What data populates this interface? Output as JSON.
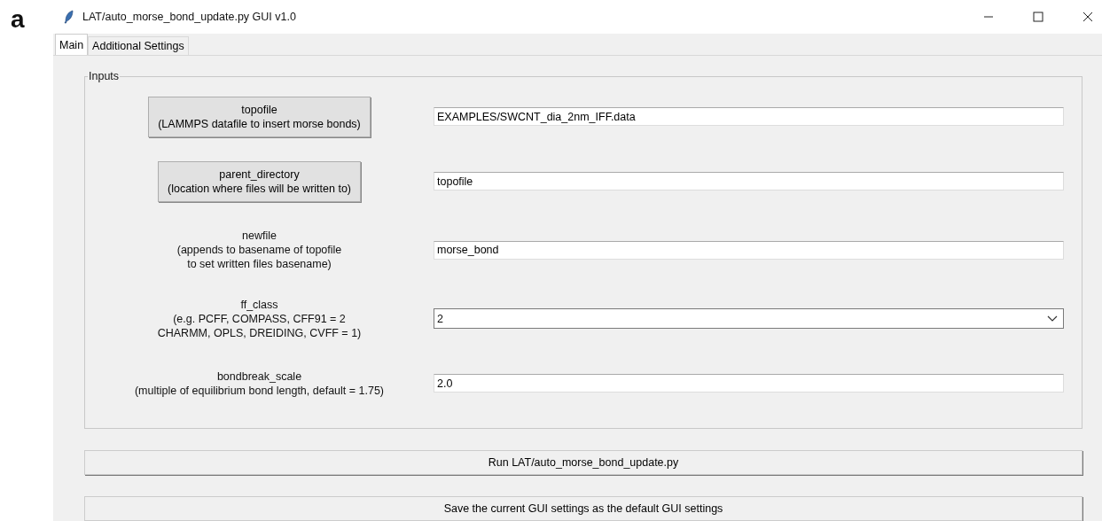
{
  "figure_label": "a",
  "window": {
    "title": "LAT/auto_morse_bond_update.py GUI v1.0"
  },
  "tabs": [
    {
      "label": "Main",
      "selected": true
    },
    {
      "label": "Additional Settings",
      "selected": false
    }
  ],
  "inputs": {
    "title": "Inputs",
    "rows": [
      {
        "label": {
          "kind": "button",
          "lines": [
            "topofile",
            "(LAMMPS datafile to insert morse bonds)"
          ]
        },
        "field": {
          "kind": "entry",
          "value": "EXAMPLES/SWCNT_dia_2nm_IFF.data"
        }
      },
      {
        "label": {
          "kind": "button",
          "lines": [
            "parent_directory",
            "(location where files will be written to)"
          ]
        },
        "field": {
          "kind": "entry",
          "value": "topofile"
        }
      },
      {
        "label": {
          "kind": "text",
          "lines": [
            "newfile",
            "(appends to basename of topofile",
            "to set written files basename)"
          ]
        },
        "field": {
          "kind": "entry",
          "value": "morse_bond"
        }
      },
      {
        "label": {
          "kind": "text",
          "lines": [
            "ff_class",
            "(e.g. PCFF, COMPASS, CFF91 = 2",
            "CHARMM, OPLS, DREIDING, CVFF = 1)"
          ]
        },
        "field": {
          "kind": "combobox",
          "value": "2"
        }
      },
      {
        "label": {
          "kind": "text",
          "lines": [
            "bondbreak_scale",
            "(multiple of equilibrium bond length, default = 1.75)"
          ]
        },
        "field": {
          "kind": "entry",
          "value": "2.0"
        }
      }
    ]
  },
  "buttons": [
    "Run LAT/auto_morse_bond_update.py",
    "Save the current GUI settings as the default GUI settings"
  ]
}
